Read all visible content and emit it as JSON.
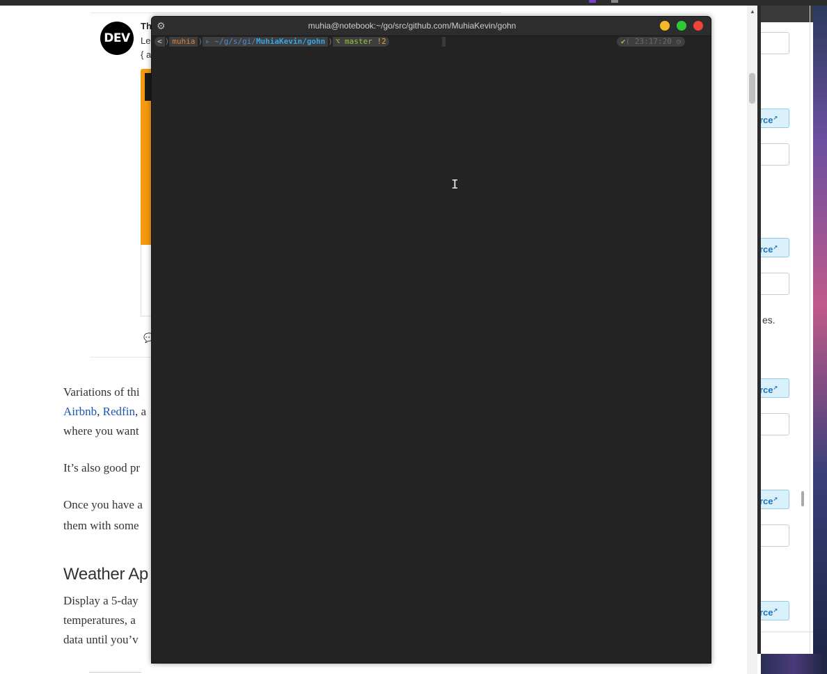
{
  "article": {
    "embed": {
      "logo_text": "DEV",
      "title_fragment": "Th",
      "subtitle_fragment": "Le",
      "subtitle2_fragment": "{ a"
    },
    "p1_line1_text": "Variations of thi",
    "p1_line2_links": [
      "Airbnb",
      "Redfin"
    ],
    "p1_line2_sep": ", ",
    "p1_line2_tail": ", a",
    "p1_line3": "where you want",
    "p2": "It’s also good pr",
    "p3_line1": "Once you have a",
    "p3_line2": "them with some",
    "heading": "Weather Ap",
    "p4_line1": "Display a 5-day",
    "p4_line2": "temperatures, a",
    "p4_line3": "data until you’v"
  },
  "right_panel": {
    "button_label": "rce",
    "button_icon": "external-link-icon",
    "text_fragment": "es."
  },
  "terminal": {
    "title": "muhia@notebook:~/go/src/github.com/MuhiaKevin/gohn",
    "prompt": {
      "os_icon": "<",
      "user": "muhia",
      "path_prefix": "~/g/s/gi/",
      "path_repo": "MuhiaKevin/gohn",
      "git_branch": "master",
      "git_status": "!2"
    },
    "right_prompt": {
      "status_icon": "✔",
      "time": "23:17:20"
    }
  },
  "colors": {
    "terminal_bg": "#232323",
    "title_min": "#f6b728",
    "title_max": "#2fcb37",
    "title_close": "#f0423a",
    "link": "#1a56b5",
    "prompt_user": "#d9823b",
    "prompt_path": "#34a5e6",
    "prompt_git": "#95c93a"
  }
}
